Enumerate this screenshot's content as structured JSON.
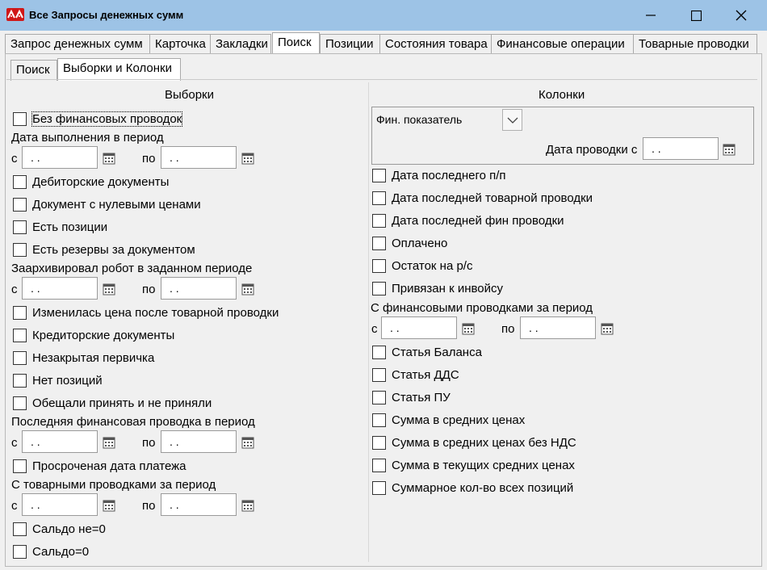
{
  "window": {
    "title": "Все Запросы денежных сумм"
  },
  "tabs": [
    "Запрос денежных сумм",
    "Карточка",
    "Закладки",
    "Поиск",
    "Позиции",
    "Состояния товара",
    "Финансовые операции",
    "Товарные проводки"
  ],
  "active_tab": "Поиск",
  "subtabs": [
    "Поиск",
    "Выборки и Колонки"
  ],
  "active_subtab": "Выборки и Колонки",
  "left": {
    "title": "Выборки",
    "no_fin": "Без финансовых проводок",
    "period1_label": "Дата выполнения в период",
    "from": "с",
    "to": "по",
    "date_mask": " .  .",
    "debit": "Дебиторские документы",
    "zero_price": "Документ с нулевыми ценами",
    "has_pos": "Есть позиции",
    "reserves": "Есть резервы за документом",
    "period2_label": "Заархивировал робот в заданном периоде",
    "price_changed": "Изменилась цена после товарной проводки",
    "credit": "Кредиторские документы",
    "unclosed": "Незакрытая первичка",
    "no_pos": "Нет позиций",
    "promised": "Обещали принять и не приняли",
    "period3_label": "Последняя финансовая проводка в период",
    "overdue": "Просроченая дата платежа",
    "period4_label": "С товарными проводками за период",
    "saldo_nz": "Сальдо не=0",
    "saldo_z": "Сальдо=0"
  },
  "right": {
    "title": "Колонки",
    "fin_indicator": "Фин. показатель",
    "posting_date_label": "Дата проводки с",
    "last_pp": "Дата последнего п/п",
    "last_goods": "Дата последней товарной проводки",
    "last_fin": "Дата последней фин проводки",
    "paid": "Оплачено",
    "balance": "Остаток на р/с",
    "invoice": "Привязан к инвойсу",
    "fin_period_label": "С финансовыми проводками за период",
    "art_balance": "Статья Баланса",
    "art_dds": "Статья ДДС",
    "art_pu": "Статья ПУ",
    "sum_avg": "Сумма в средних ценах",
    "sum_avg_novat": "Сумма в средних ценах без НДС",
    "sum_cur_avg": "Сумма в текущих средних ценах",
    "total_qty": "Суммарное кол-во всех позиций"
  }
}
